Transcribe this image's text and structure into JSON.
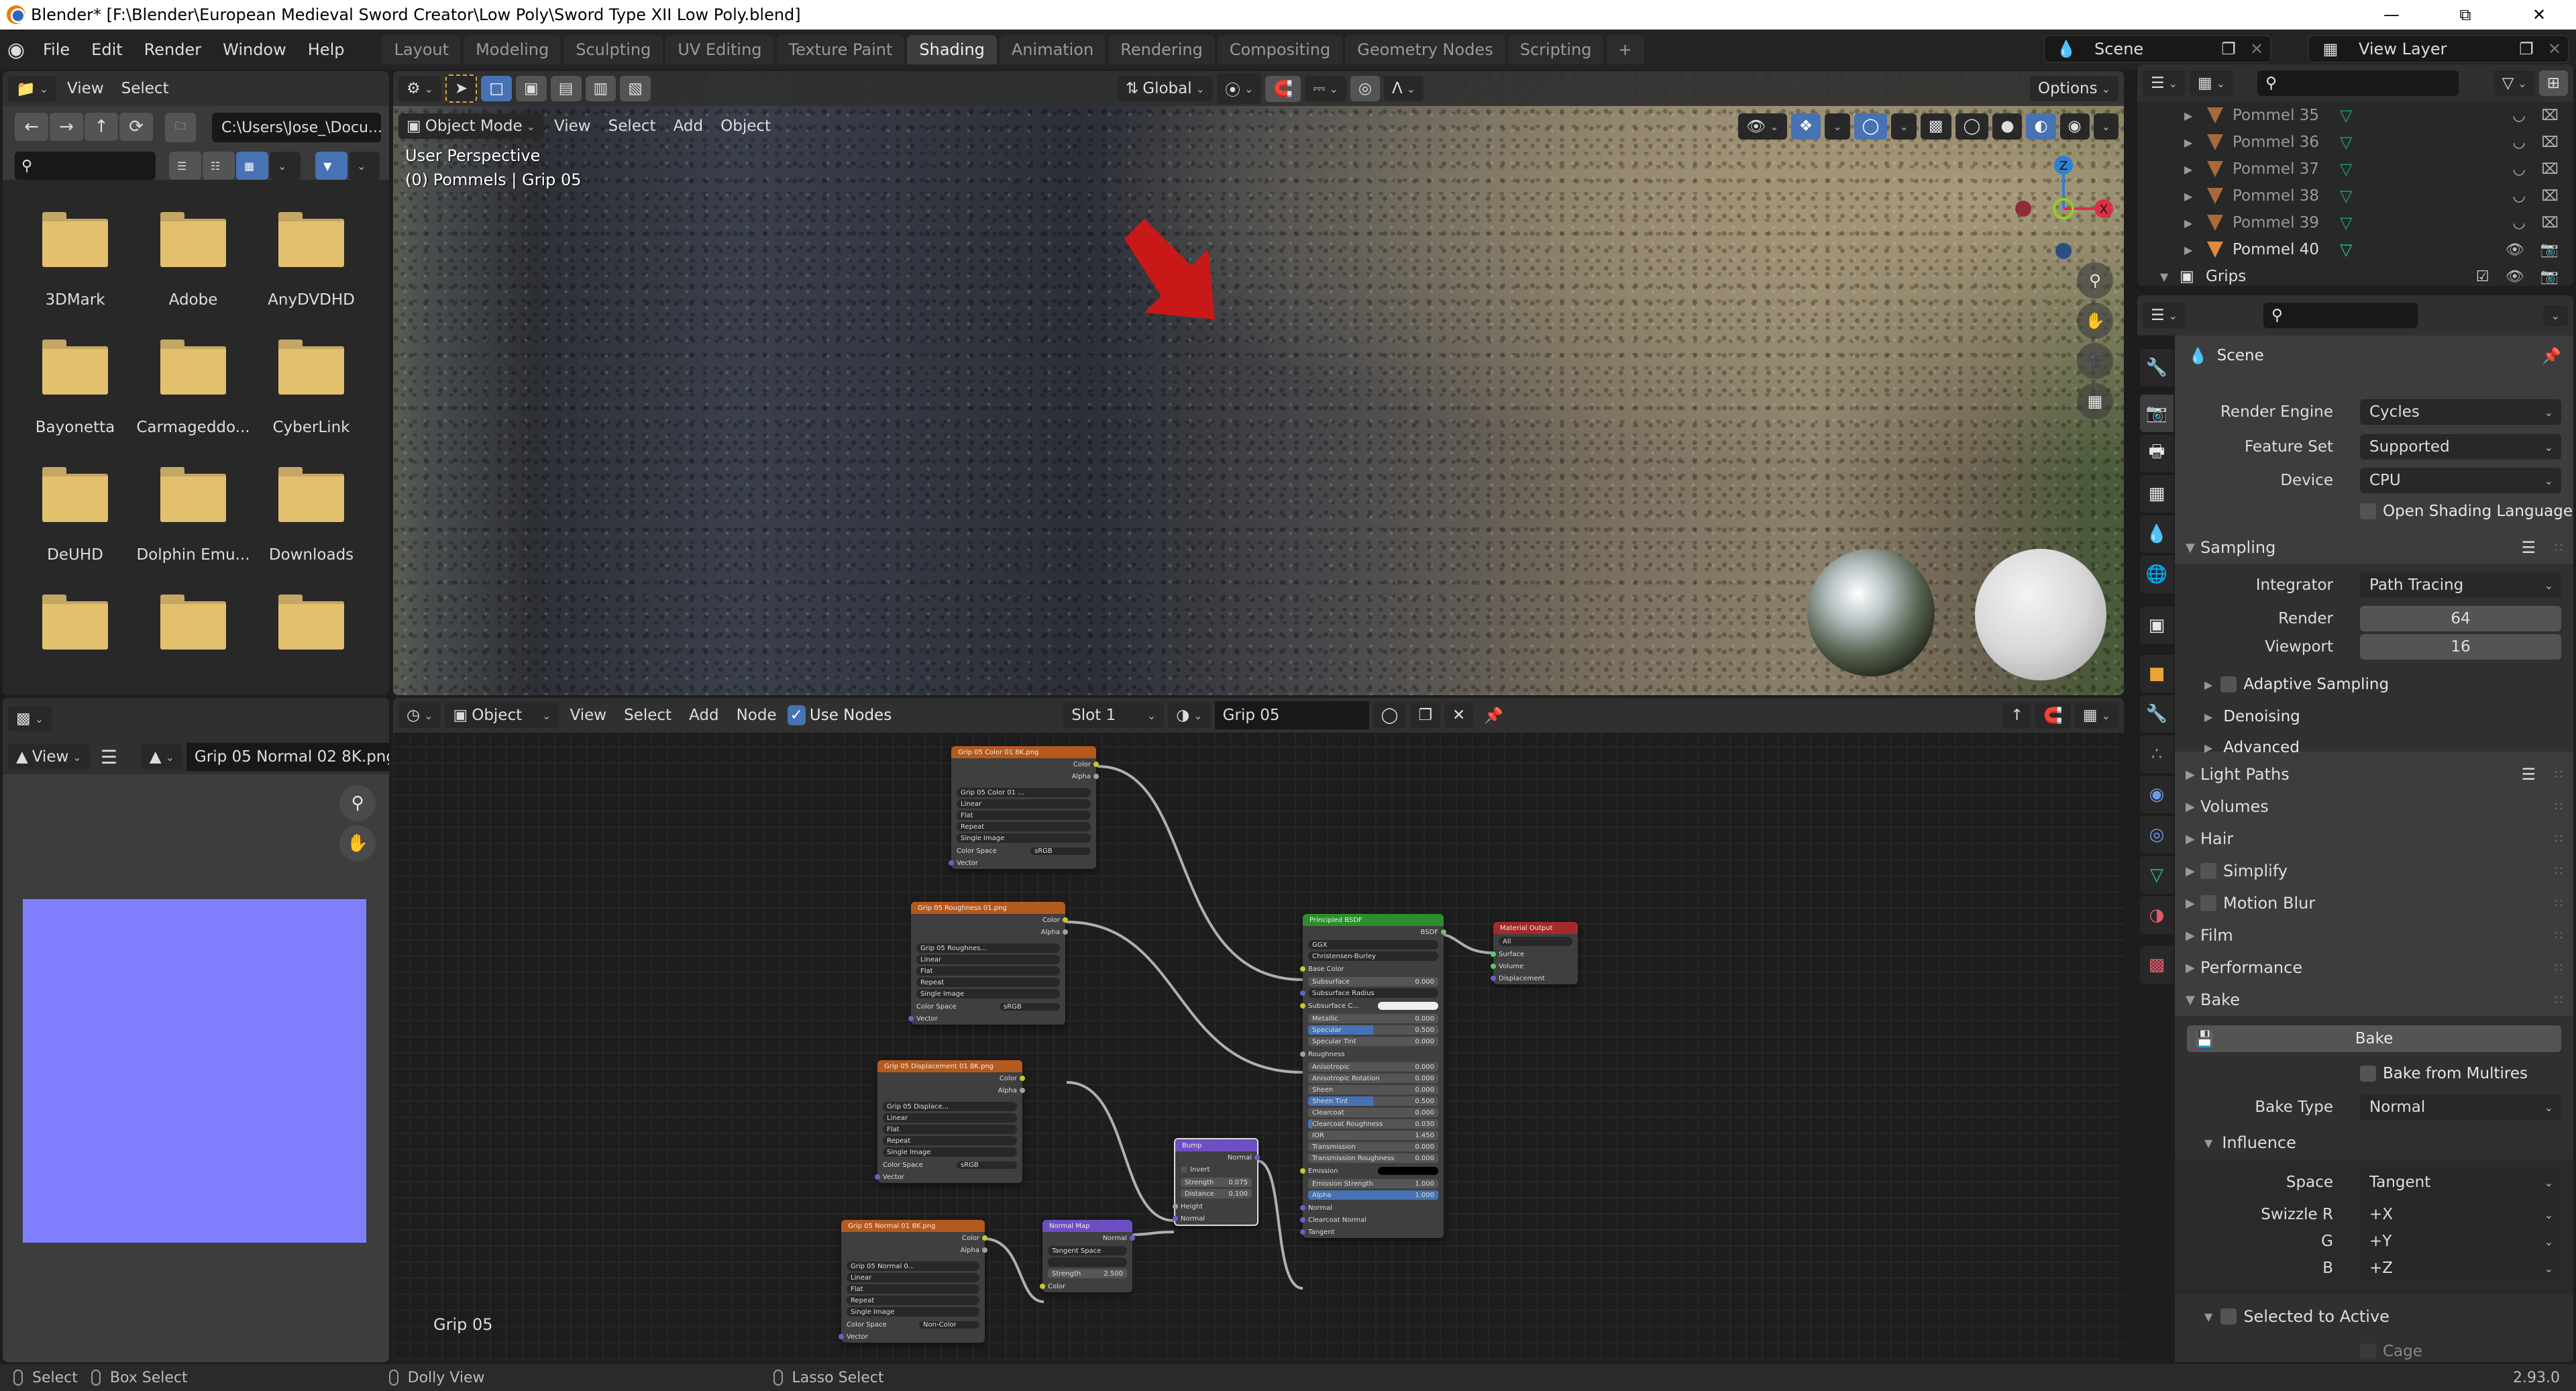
{
  "window": {
    "title": "Blender* [F:\\Blender\\European Medieval Sword Creator\\Low Poly\\Sword Type XII Low Poly.blend]"
  },
  "topbar": {
    "menus": [
      "File",
      "Edit",
      "Render",
      "Window",
      "Help"
    ],
    "workspaces": [
      "Layout",
      "Modeling",
      "Sculpting",
      "UV Editing",
      "Texture Paint",
      "Shading",
      "Animation",
      "Rendering",
      "Compositing",
      "Geometry Nodes",
      "Scripting",
      "+"
    ],
    "active_workspace": "Shading",
    "scene": "Scene",
    "view_layer": "View Layer"
  },
  "file_browser": {
    "menus": [
      "View",
      "Select"
    ],
    "path": "C:\\Users\\Jose_\\Docu...",
    "search_placeholder": "",
    "folders": [
      "3DMark",
      "Adobe",
      "AnyDVDHD",
      "Bayonetta",
      "Carmageddo...",
      "CyberLink",
      "DeUHD",
      "Dolphin Emu...",
      "Downloads",
      "",
      "",
      ""
    ]
  },
  "image_editor": {
    "view_label": "View",
    "image_name": "Grip 05 Normal 02 8K.png",
    "preview_color": "#8080ff"
  },
  "viewport": {
    "mode": "Object Mode",
    "menus": [
      "View",
      "Select",
      "Add",
      "Object"
    ],
    "orientation": "Global",
    "options_label": "Options",
    "overlay_line1": "User Perspective",
    "overlay_line2": "(0) Pommels | Grip 05",
    "gizmo": {
      "x": "X",
      "z": "Z"
    }
  },
  "outliner": {
    "rows": [
      {
        "name": "Pommel 35",
        "visible": false
      },
      {
        "name": "Pommel 36",
        "visible": false
      },
      {
        "name": "Pommel 37",
        "visible": false
      },
      {
        "name": "Pommel 38",
        "visible": false
      },
      {
        "name": "Pommel 39",
        "visible": false
      },
      {
        "name": "Pommel 40",
        "visible": true
      }
    ],
    "collection": "Grips"
  },
  "properties": {
    "context": "Scene",
    "render_engine": {
      "label": "Render Engine",
      "value": "Cycles"
    },
    "feature_set": {
      "label": "Feature Set",
      "value": "Supported"
    },
    "device": {
      "label": "Device",
      "value": "CPU"
    },
    "osl": {
      "label": "Open Shading Language",
      "checked": false
    },
    "sampling": {
      "title": "Sampling",
      "integrator": {
        "label": "Integrator",
        "value": "Path Tracing"
      },
      "render": {
        "label": "Render",
        "value": "64"
      },
      "viewport": {
        "label": "Viewport",
        "value": "16"
      },
      "subpanels": [
        "Adaptive Sampling",
        "Denoising",
        "Advanced"
      ]
    },
    "sections": [
      "Light Paths",
      "Volumes",
      "Hair",
      "Simplify",
      "Motion Blur",
      "Film",
      "Performance"
    ],
    "bake": {
      "title": "Bake",
      "button": "Bake",
      "from_multires": "Bake from Multires",
      "bake_type": {
        "label": "Bake Type",
        "value": "Normal"
      },
      "influence": "Influence",
      "space": {
        "label": "Space",
        "value": "Tangent"
      },
      "swizzle_r": {
        "label": "Swizzle R",
        "value": "+X"
      },
      "swizzle_g": {
        "label": "G",
        "value": "+Y"
      },
      "swizzle_b": {
        "label": "B",
        "value": "+Z"
      },
      "selected_to_active": "Selected to Active",
      "cage": "Cage"
    }
  },
  "node_editor": {
    "type": "Object",
    "menus": [
      "View",
      "Select",
      "Add",
      "Node"
    ],
    "use_nodes": {
      "label": "Use Nodes",
      "checked": true
    },
    "slot": "Slot 1",
    "material": "Grip 05",
    "frame_label": "Grip 05",
    "nodes": {
      "color_tex": {
        "title": "Grip 05 Color 01 8K.png",
        "image": "Grip 05 Color 01 ...",
        "interp": "Linear",
        "proj": "Flat",
        "ext": "Repeat",
        "source": "Single Image",
        "cs_label": "Color Space",
        "cs": "sRGB"
      },
      "rough_tex": {
        "title": "Grip 05 Roughness 01.png",
        "image": "Grip 05 Roughnes...",
        "interp": "Linear",
        "proj": "Flat",
        "ext": "Repeat",
        "source": "Single Image",
        "cs_label": "Color Space",
        "cs": "sRGB"
      },
      "disp_tex": {
        "title": "Grip 05 Displacement 01 8K.png",
        "image": "Grip 05 Displace...",
        "interp": "Linear",
        "proj": "Flat",
        "ext": "Repeat",
        "source": "Single Image",
        "cs_label": "Color Space",
        "cs": "sRGB"
      },
      "normal_tex": {
        "title": "Grip 05 Normal 01 8K.png",
        "image": "Grip 05 Normal 0...",
        "interp": "Linear",
        "proj": "Flat",
        "ext": "Repeat",
        "source": "Single Image",
        "cs_label": "Color Space",
        "cs": "Non-Color"
      },
      "socket_labels": {
        "color": "Color",
        "alpha": "Alpha",
        "vector": "Vector"
      },
      "normal_map": {
        "title": "Normal Map",
        "out": "Normal",
        "space": "Tangent Space",
        "strength_label": "Strength",
        "strength": "2.500",
        "in": "Color"
      },
      "bump": {
        "title": "Bump",
        "out": "Normal",
        "invert": "Invert",
        "strength_label": "Strength",
        "strength": "0.075",
        "distance_label": "Distance",
        "distance": "0.100",
        "height": "Height",
        "normal": "Normal"
      },
      "bsdf": {
        "title": "Principled BSDF",
        "out": "BSDF",
        "dist": "GGX",
        "ss_method": "Christensen-Burley",
        "rows": [
          {
            "label": "Base Color",
            "kind": "socket"
          },
          {
            "label": "Subsurface",
            "value": "0.000"
          },
          {
            "label": "Subsurface Radius",
            "kind": "menu"
          },
          {
            "label": "Subsurface C...",
            "kind": "color-white"
          },
          {
            "label": "Metallic",
            "value": "0.000"
          },
          {
            "label": "Specular",
            "value": "0.500",
            "fill": 0.5
          },
          {
            "label": "Specular Tint",
            "value": "0.000"
          },
          {
            "label": "Roughness",
            "kind": "socket"
          },
          {
            "label": "Anisotropic",
            "value": "0.000"
          },
          {
            "label": "Anisotropic Rotation",
            "value": "0.000"
          },
          {
            "label": "Sheen",
            "value": "0.000"
          },
          {
            "label": "Sheen Tint",
            "value": "0.500",
            "fill": 0.5
          },
          {
            "label": "Clearcoat",
            "value": "0.000"
          },
          {
            "label": "Clearcoat Roughness",
            "value": "0.030",
            "fill": 0.03
          },
          {
            "label": "IOR",
            "value": "1.450"
          },
          {
            "label": "Transmission",
            "value": "0.000"
          },
          {
            "label": "Transmission Roughness",
            "value": "0.000"
          },
          {
            "label": "Emission",
            "kind": "color-black"
          },
          {
            "label": "Emission Strength",
            "value": "1.000"
          },
          {
            "label": "Alpha",
            "value": "1.000",
            "fill": 1.0
          },
          {
            "label": "Normal",
            "kind": "socket"
          },
          {
            "label": "Clearcoat Normal",
            "kind": "socket"
          },
          {
            "label": "Tangent",
            "kind": "socket"
          }
        ]
      },
      "output": {
        "title": "Material Output",
        "target": "All",
        "inputs": [
          "Surface",
          "Volume",
          "Displacement"
        ]
      }
    }
  },
  "statusbar": {
    "items": [
      "Select",
      "Box Select",
      "Dolly View",
      "Lasso Select"
    ],
    "version": "2.93.0"
  },
  "colors": {
    "accent": "#4772b3",
    "folder": "#e3c06e",
    "image_node": "#b45a1e",
    "shader_node": "#2b8f2b",
    "vector_node": "#6e4fc2",
    "output_node": "#a52a2a"
  }
}
